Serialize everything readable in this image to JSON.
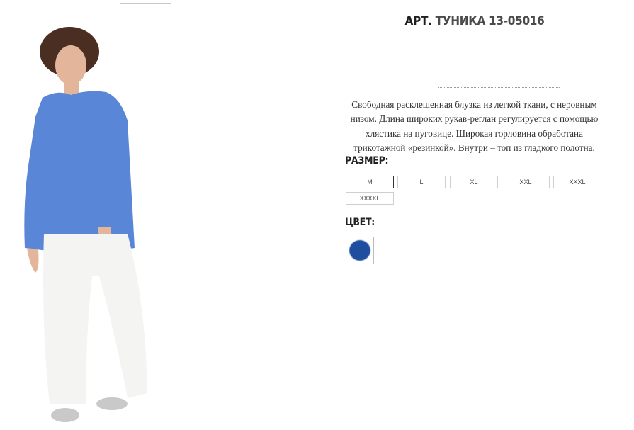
{
  "product": {
    "title_prefix": "АРТ.",
    "title_name": "ТУНИКА 13-05016",
    "description": "Свободная расклешенная блузка из легкой ткани, с неровным низом. Длина широких рукав-реглан регулируется с помощью хлястика на пуговице. Широкая горловина обработана трикотажной «резинкой». Внутри – топ из гладкого полотна."
  },
  "size": {
    "label": "РАЗМЕР:",
    "options": [
      "M",
      "L",
      "XL",
      "XXL",
      "XXXL",
      "XXXXL"
    ],
    "selected": "M"
  },
  "color": {
    "label": "ЦВЕТ:",
    "swatch_hex": "#1f4e9e"
  },
  "photo": {
    "tunic_color": "#5a86d8",
    "pants_color": "#f4f4f2",
    "skin_color": "#e3b59a",
    "hair_color": "#4a2e22"
  }
}
